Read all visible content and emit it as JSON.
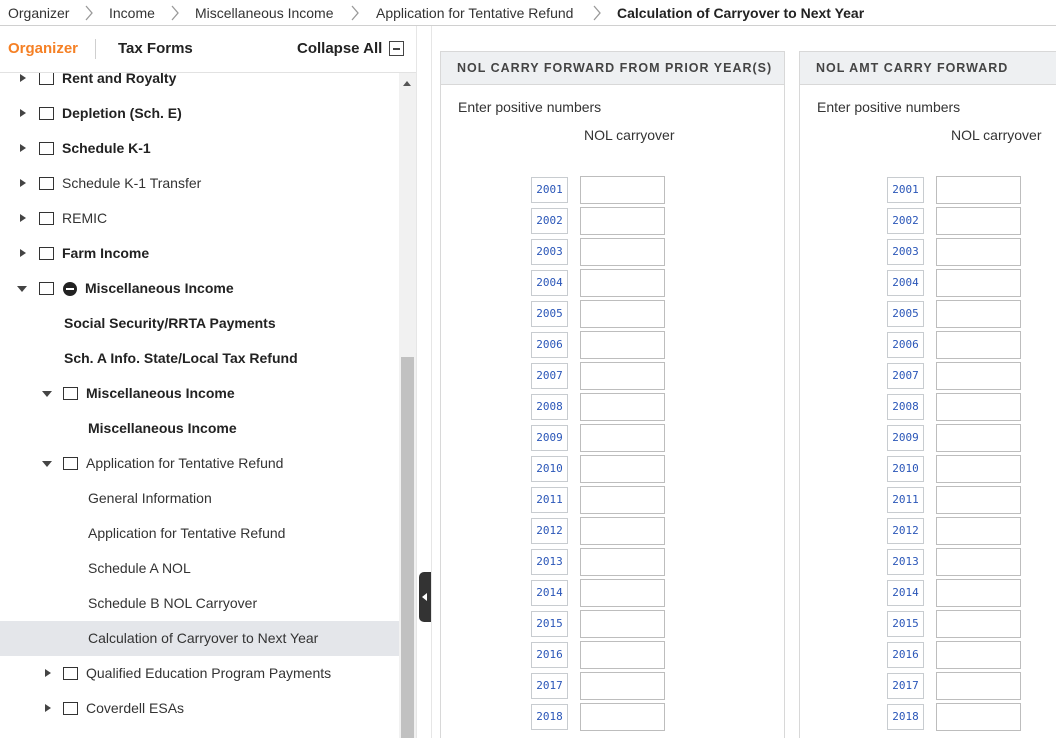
{
  "breadcrumb": {
    "items": [
      "Organizer",
      "Income",
      "Miscellaneous Income",
      "Application for Tentative Refund"
    ],
    "current": "Calculation of Carryover to Next Year"
  },
  "sidebar": {
    "tabs": {
      "organizer": "Organizer",
      "tax_forms": "Tax Forms"
    },
    "collapse_all": "Collapse All",
    "tree": [
      {
        "label": "Rent and Royalty",
        "bold": true
      },
      {
        "label": "Depletion (Sch. E)",
        "bold": true
      },
      {
        "label": "Schedule K-1",
        "bold": true
      },
      {
        "label": "Schedule K-1 Transfer",
        "bold": false
      },
      {
        "label": "REMIC",
        "bold": false
      },
      {
        "label": "Farm Income",
        "bold": true
      },
      {
        "label": "Miscellaneous Income",
        "bold": true
      },
      {
        "label": "Social Security/RRTA Payments",
        "bold": true
      },
      {
        "label": "Sch. A Info. State/Local Tax Refund",
        "bold": true
      },
      {
        "label": "Miscellaneous Income",
        "bold": true
      },
      {
        "label": "Miscellaneous Income",
        "bold": true
      },
      {
        "label": "Application for Tentative Refund",
        "bold": false
      },
      {
        "label": "General Information",
        "bold": false
      },
      {
        "label": "Application for Tentative Refund",
        "bold": false
      },
      {
        "label": "Schedule A NOL",
        "bold": false
      },
      {
        "label": "Schedule B NOL Carryover",
        "bold": false
      },
      {
        "label": "Calculation of Carryover to Next Year",
        "bold": false,
        "selected": true
      },
      {
        "label": "Qualified Education Program Payments",
        "bold": false
      },
      {
        "label": "Coverdell ESAs",
        "bold": false
      }
    ]
  },
  "panels": [
    {
      "title": "NOL CARRY FORWARD FROM PRIOR YEAR(S)",
      "hint": "Enter positive numbers",
      "column": "NOL carryover",
      "years": [
        "2001",
        "2002",
        "2003",
        "2004",
        "2005",
        "2006",
        "2007",
        "2008",
        "2009",
        "2010",
        "2011",
        "2012",
        "2013",
        "2014",
        "2015",
        "2016",
        "2017",
        "2018"
      ],
      "values": [
        "",
        "",
        "",
        "",
        "",
        "",
        "",
        "",
        "",
        "",
        "",
        "",
        "",
        "",
        "",
        "",
        "",
        ""
      ]
    },
    {
      "title": "NOL AMT CARRY FORWARD",
      "hint": "Enter positive numbers",
      "column": "NOL carryover",
      "years": [
        "2001",
        "2002",
        "2003",
        "2004",
        "2005",
        "2006",
        "2007",
        "2008",
        "2009",
        "2010",
        "2011",
        "2012",
        "2013",
        "2014",
        "2015",
        "2016",
        "2017",
        "2018"
      ],
      "values": [
        "",
        "",
        "",
        "",
        "",
        "",
        "",
        "",
        "",
        "",
        "",
        "",
        "",
        "",
        "",
        "",
        "",
        ""
      ]
    }
  ],
  "colors": {
    "accent": "#f58025",
    "year_link": "#2a56b8",
    "selected_row": "#e4e6ea",
    "panel_header": "#eef0f2"
  }
}
